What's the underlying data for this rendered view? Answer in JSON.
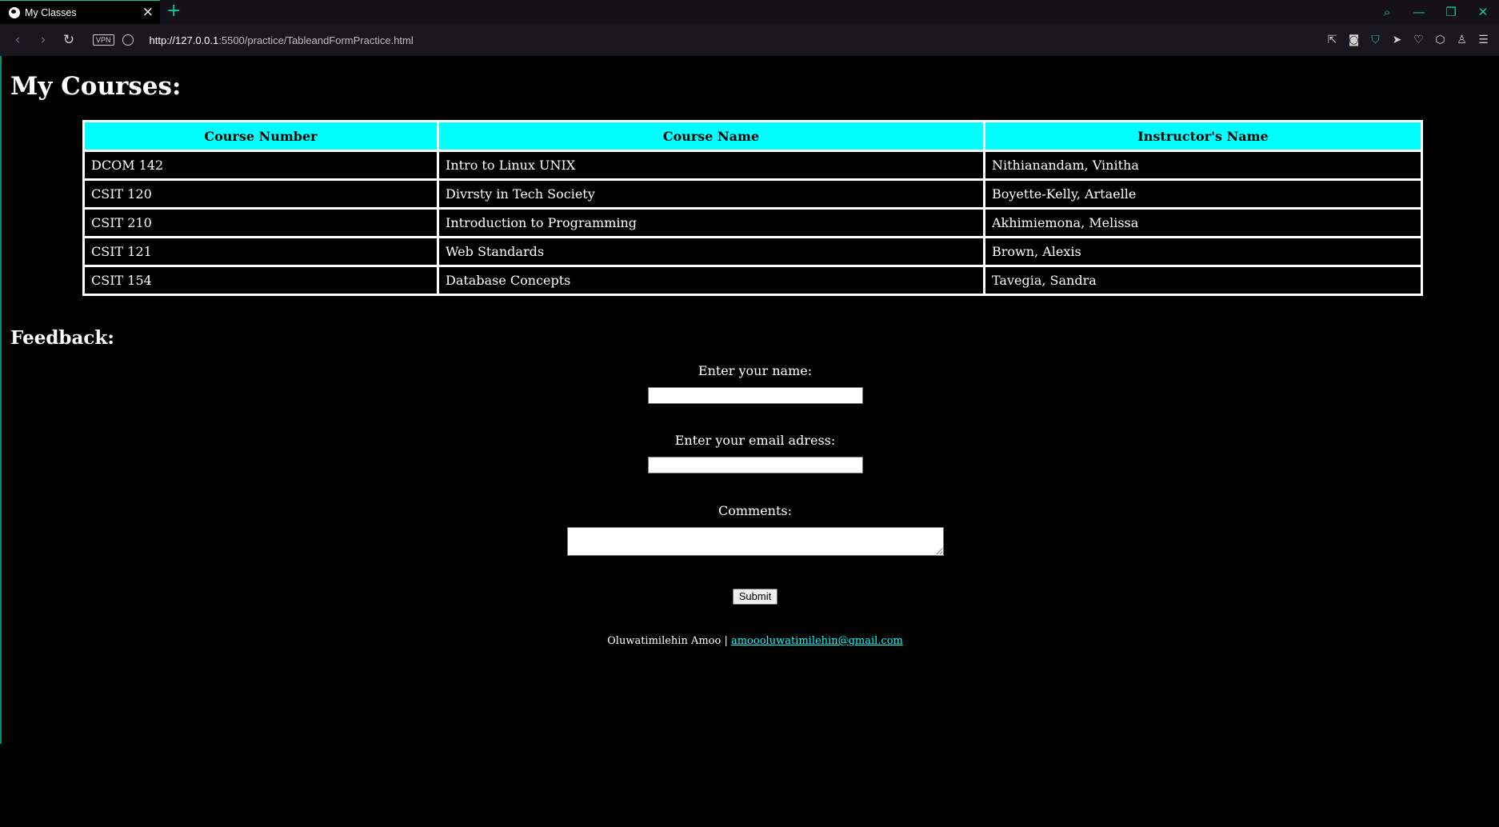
{
  "browser": {
    "tab_title": "My Classes",
    "url_host": "http://127.0.0.1",
    "url_path": ":5500/practice/TableandFormPractice.html",
    "vpn_label": "VPN",
    "accent_color": "#13c6a0"
  },
  "page": {
    "heading": "My Courses:",
    "table": {
      "headers": [
        "Course Number",
        "Course Name",
        "Instructor's Name"
      ],
      "header_bg": "#00ffff",
      "rows": [
        [
          "DCOM 142",
          "Intro to Linux UNIX",
          "Nithianandam, Vinitha"
        ],
        [
          "CSIT 120",
          "Divrsty in Tech Society",
          "Boyette-Kelly, Artaelle"
        ],
        [
          "CSIT 210",
          "Introduction to Programming",
          "Akhimiemona, Melissa"
        ],
        [
          "CSIT 121",
          "Web Standards",
          "Brown, Alexis"
        ],
        [
          "CSIT 154",
          "Database Concepts",
          "Tavegia, Sandra"
        ]
      ]
    },
    "feedback_heading": "Feedback:",
    "form": {
      "name_label": "Enter your name:",
      "name_value": "",
      "email_label": "Enter your email adress:",
      "email_value": "",
      "comments_label": "Comments:",
      "comments_value": "",
      "submit_label": "Submit"
    },
    "footer": {
      "author": "Oluwatimilehin Amoo |",
      "email": "amoooluwatimilehin@gmail.com"
    }
  }
}
